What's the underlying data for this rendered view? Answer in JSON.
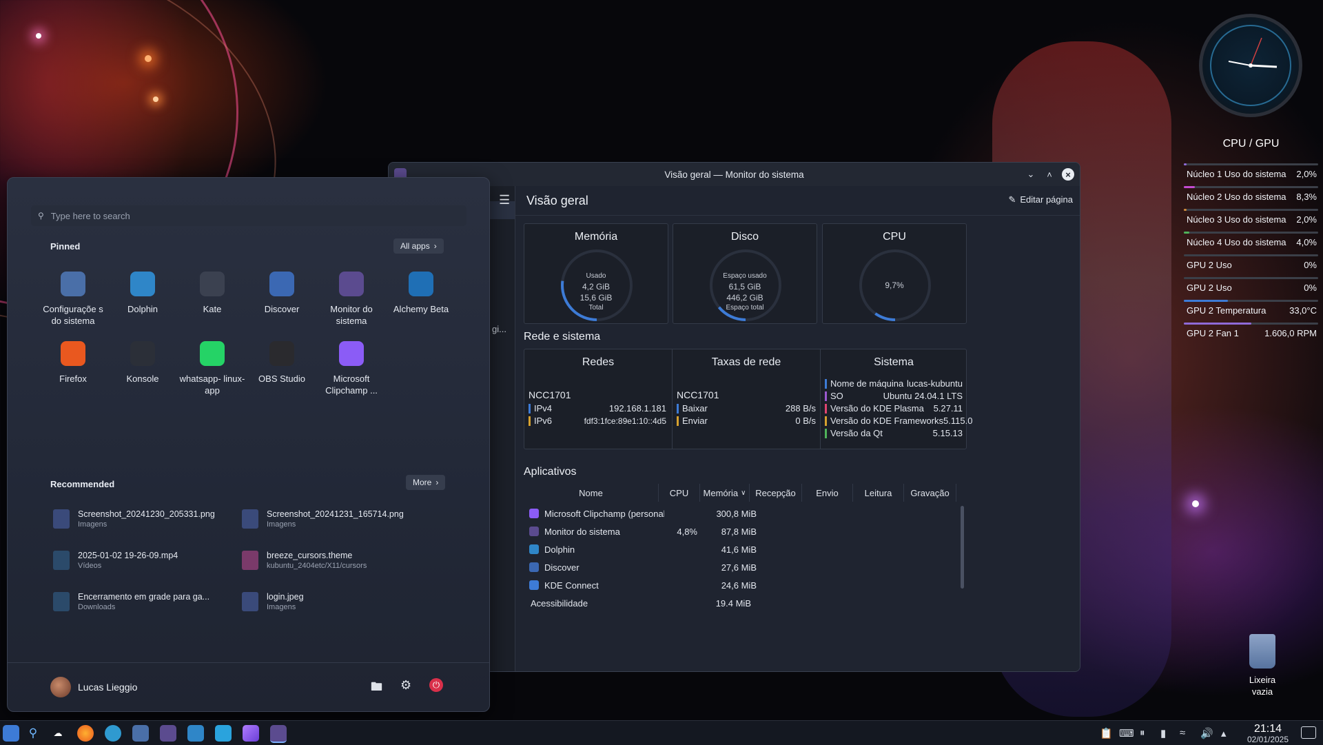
{
  "start_menu": {
    "search_placeholder": "Type here to search",
    "pinned_label": "Pinned",
    "all_apps_label": "All apps",
    "pinned_apps": [
      {
        "label": "Configuraçõe s do sistema",
        "icon": "settings-icon",
        "color": "#4a6fa8"
      },
      {
        "label": "Dolphin",
        "icon": "dolphin-icon",
        "color": "#2f86c8"
      },
      {
        "label": "Kate",
        "icon": "kate-icon",
        "color": "#3b4150"
      },
      {
        "label": "Discover",
        "icon": "discover-icon",
        "color": "#3b68b3"
      },
      {
        "label": "Monitor do sistema",
        "icon": "system-monitor-icon",
        "color": "#5b4b8f"
      },
      {
        "label": "Alchemy Beta",
        "icon": "alchemy-icon",
        "color": "#1f6fb5"
      },
      {
        "label": "Firefox",
        "icon": "firefox-icon",
        "color": "#e9581f"
      },
      {
        "label": "Konsole",
        "icon": "konsole-icon",
        "color": "#2b2f38"
      },
      {
        "label": "whatsapp- linux-app",
        "icon": "whatsapp-icon",
        "color": "#25d366"
      },
      {
        "label": "OBS Studio",
        "icon": "obs-icon",
        "color": "#2a2a2e"
      },
      {
        "label": "Microsoft Clipchamp ...",
        "icon": "clipchamp-icon",
        "color": "#8b5cf6"
      }
    ],
    "recommended_label": "Recommended",
    "more_label": "More",
    "recommended": [
      {
        "name": "Screenshot_20241230_205331.png",
        "sub": "Imagens",
        "icon": "image-file-icon"
      },
      {
        "name": "Screenshot_20241231_165714.png",
        "sub": "Imagens",
        "icon": "image-file-icon"
      },
      {
        "name": "2025-01-02 19-26-09.mp4",
        "sub": "Vídeos",
        "icon": "video-file-icon"
      },
      {
        "name": "breeze_cursors.theme",
        "sub": "kubuntu_2404etc/X11/cursors",
        "icon": "theme-file-icon"
      },
      {
        "name": "Encerramento em grade para ga...",
        "sub": "Downloads",
        "icon": "video-file-icon"
      },
      {
        "name": "login.jpeg",
        "sub": "Imagens",
        "icon": "image-file-icon"
      }
    ],
    "user_name": "Lucas Lieggio"
  },
  "monitor": {
    "window_title": "Visão geral — Monitor do sistema",
    "page_title": "Visão geral",
    "edit_page": "Editar página",
    "side_fragment": "gi...",
    "memory": {
      "title": "Memória",
      "label_top": "Usado",
      "used": "4,2 GiB",
      "total": "15,6 GiB",
      "label_bottom": "Total",
      "fraction": 0.27
    },
    "disk": {
      "title": "Disco",
      "label_top": "Espaço usado",
      "used": "61,5 GiB",
      "total": "446,2 GiB",
      "label_bottom": "Espaço total",
      "fraction": 0.14
    },
    "cpu": {
      "title": "CPU",
      "value": "9,7%",
      "fraction": 0.097
    },
    "net_section_title": "Rede e sistema",
    "networks": {
      "title": "Redes",
      "name": "NCC1701",
      "ipv4_label": "IPv4",
      "ipv4": "192.168.1.181",
      "ipv6_label": "IPv6",
      "ipv6": "fdf3:1fce:89e1:10::4d5"
    },
    "rates": {
      "title": "Taxas de rede",
      "name": "NCC1701",
      "down_label": "Baixar",
      "down": "288 B/s",
      "up_label": "Enviar",
      "up": "0 B/s"
    },
    "system": {
      "title": "Sistema",
      "rows": [
        {
          "label": "Nome de máquina",
          "value": "lucas-kubuntu",
          "color": "#3d7bd6"
        },
        {
          "label": "SO",
          "value": "Ubuntu 24.04.1 LTS",
          "color": "#9b59d0"
        },
        {
          "label": "Versão do KDE Plasma",
          "value": "5.27.11",
          "color": "#e0446f"
        },
        {
          "label": "Versão do KDE Frameworks",
          "value": "5.115.0",
          "color": "#d6a12f"
        },
        {
          "label": "Versão da Qt",
          "value": "5.15.13",
          "color": "#4fb35a"
        }
      ]
    },
    "apps_section_title": "Aplicativos",
    "columns": [
      "Nome",
      "CPU",
      "Memória",
      "Recepção",
      "Envio",
      "Leitura",
      "Gravação"
    ],
    "processes": [
      {
        "name": "Microsoft Clipchamp (personal ...",
        "cpu": "",
        "mem": "300,8 MiB",
        "color": "#8b5cf6"
      },
      {
        "name": "Monitor do sistema",
        "cpu": "4,8%",
        "mem": "87,8 MiB",
        "color": "#5b4b8f"
      },
      {
        "name": "Dolphin",
        "cpu": "",
        "mem": "41,6 MiB",
        "color": "#2f86c8"
      },
      {
        "name": "Discover",
        "cpu": "",
        "mem": "27,6 MiB",
        "color": "#3b68b3"
      },
      {
        "name": "KDE Connect",
        "cpu": "",
        "mem": "24,6 MiB",
        "color": "#3d7bd6"
      },
      {
        "name": "Acessibilidade",
        "cpu": "",
        "mem": "19.4 MiB",
        "color": ""
      }
    ]
  },
  "widgets": {
    "sensors_title": "CPU / GPU",
    "sensors": [
      {
        "label": "Núcleo 1 Uso do sistema",
        "value": "2,0%",
        "fraction": 0.02,
        "color": "#8f6ad8"
      },
      {
        "label": "Núcleo 2 Uso do sistema",
        "value": "8,3%",
        "fraction": 0.083,
        "color": "#c44bd0"
      },
      {
        "label": "Núcleo 3 Uso do sistema",
        "value": "2,0%",
        "fraction": 0.02,
        "color": "#d08a3a"
      },
      {
        "label": "Núcleo 4 Uso do sistema",
        "value": "4,0%",
        "fraction": 0.04,
        "color": "#4fb35a"
      },
      {
        "label": "GPU 2 Uso",
        "value": "0%",
        "fraction": 0.0,
        "color": "#3d7bd6"
      },
      {
        "label": "GPU 2 Uso",
        "value": "0%",
        "fraction": 0.0,
        "color": "#3d7bd6"
      },
      {
        "label": "GPU 2 Temperatura",
        "value": "33,0°C",
        "fraction": 0.33,
        "color": "#3d7bd6"
      },
      {
        "label": "GPU 2 Fan 1",
        "value": "1.606,0 RPM",
        "fraction": 0.5,
        "color": "#8f6ad8"
      }
    ],
    "trash_label": "Lixeira vazia"
  },
  "taskbar": {
    "time": "21:14",
    "date": "02/01/2025"
  }
}
